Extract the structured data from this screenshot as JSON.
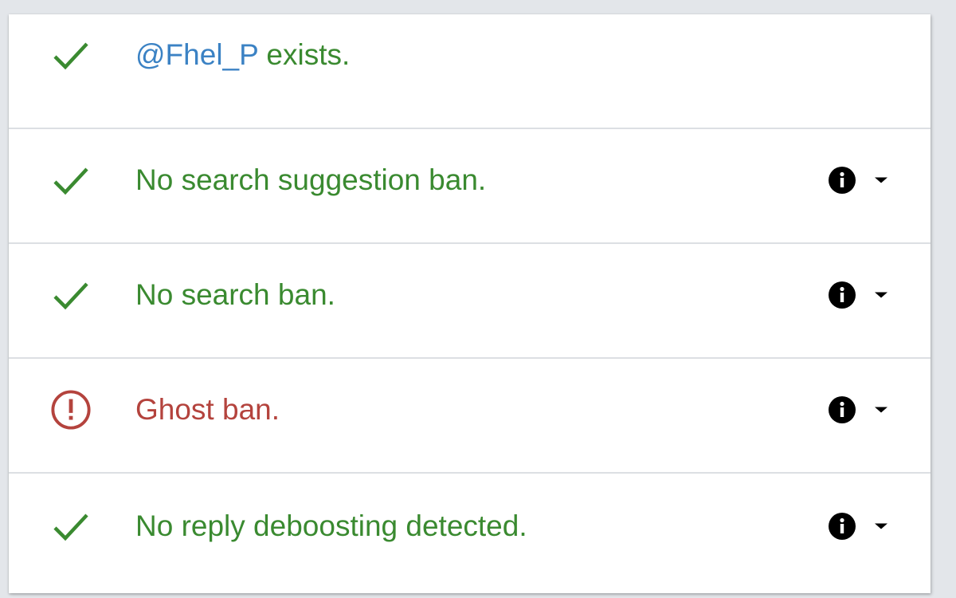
{
  "colors": {
    "ok": "#3a8a30",
    "bad": "#b4433d",
    "handle": "#3b82c4"
  },
  "results": [
    {
      "status": "ok",
      "icon": "check-icon",
      "handle": "@Fhel_P",
      "text": " exists.",
      "has_details": false
    },
    {
      "status": "ok",
      "icon": "check-icon",
      "text": "No search suggestion ban.",
      "has_details": true
    },
    {
      "status": "ok",
      "icon": "check-icon",
      "text": "No search ban.",
      "has_details": true
    },
    {
      "status": "bad",
      "icon": "alert-circle-icon",
      "text": "Ghost ban.",
      "has_details": true
    },
    {
      "status": "ok",
      "icon": "check-icon",
      "text": "No reply deboosting detected.",
      "has_details": true
    }
  ]
}
